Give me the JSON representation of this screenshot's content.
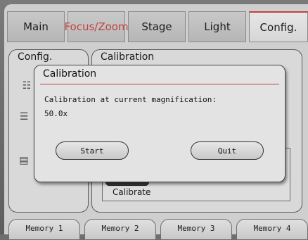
{
  "tabs": [
    "Main",
    "Focus/Zoom",
    "Stage",
    "Light",
    "Config."
  ],
  "active_tab": "Focus/Zoom",
  "left_panel": {
    "label": "Config."
  },
  "right_panel": {
    "label": "Calibration",
    "calibrate_label": "Calibrate"
  },
  "dialog": {
    "title": "Calibration",
    "message": "Calibration at current magnification:",
    "value": "50.0x",
    "start_label": "Start",
    "quit_label": "Quit"
  },
  "memory_tabs": [
    "Memory 1",
    "Memory 2",
    "Memory 3",
    "Memory 4"
  ],
  "colors": {
    "accent": "#c44040",
    "background": "#cfcfcf"
  }
}
